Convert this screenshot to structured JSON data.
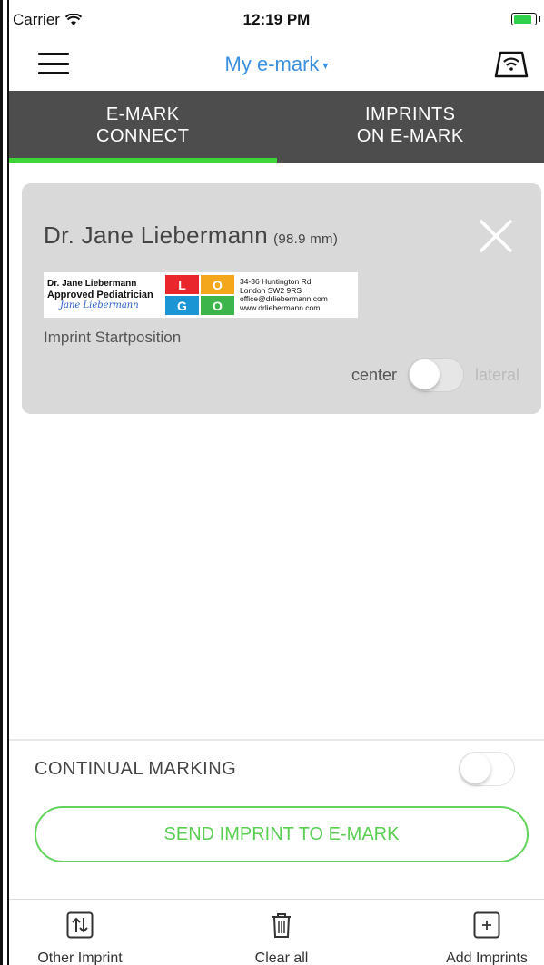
{
  "status_bar": {
    "carrier": "Carrier",
    "time": "12:19 PM"
  },
  "nav": {
    "title": "My e-mark",
    "caret": "▾"
  },
  "tabs": [
    {
      "line1": "E-MARK",
      "line2": "CONNECT",
      "active": true
    },
    {
      "line1": "IMPRINTS",
      "line2": "ON E-MARK",
      "active": false
    }
  ],
  "card": {
    "name": "Dr. Jane Liebermann",
    "size": "(98.9 mm)",
    "imprint": {
      "line1": "Dr. Jane Liebermann",
      "line2": "Approved Pediatrician",
      "signature": "Jane Liebermann",
      "logo": [
        "L",
        "O",
        "G",
        "O"
      ],
      "logo_colors": [
        "#e8262b",
        "#f5a71c",
        "#1b95d4",
        "#3cb54a"
      ],
      "address": [
        "34-36 Huntington Rd",
        "London SW2 9RS",
        "office@drliebermann.com",
        "www.drliebermann.com"
      ]
    },
    "startposition_label": "Imprint Startposition",
    "toggle_left": "center",
    "toggle_right": "lateral"
  },
  "continual_marking": {
    "label": "CONTINUAL MARKING"
  },
  "send_button": "SEND IMPRINT TO E-MARK",
  "tabbar": {
    "other_imprint": "Other Imprint",
    "clear_all": "Clear all",
    "add_imprints": "Add Imprints"
  },
  "colors": {
    "accent_green": "#3fd43a",
    "link_blue": "#3b8fe0",
    "tab_bg": "#4d4d4d"
  }
}
